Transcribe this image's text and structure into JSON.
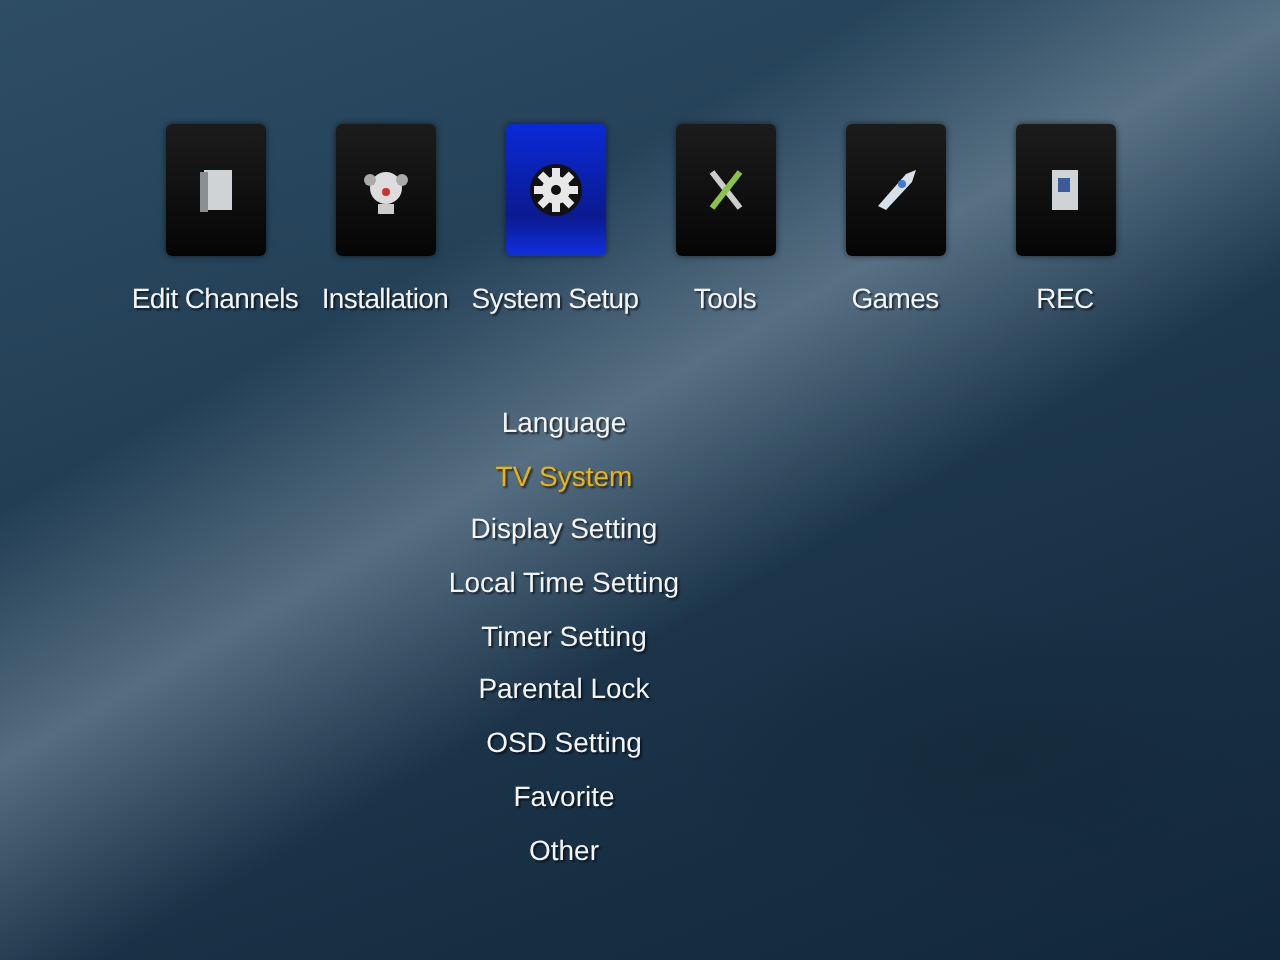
{
  "main_menu": [
    {
      "label": "Edit Channels",
      "selected": false
    },
    {
      "label": "Installation",
      "selected": false
    },
    {
      "label": "System Setup",
      "selected": true
    },
    {
      "label": "Tools",
      "selected": false
    },
    {
      "label": "Games",
      "selected": false
    },
    {
      "label": "REC",
      "selected": false
    }
  ],
  "submenu": [
    {
      "label": "Language",
      "selected": false
    },
    {
      "label": "TV System",
      "selected": true
    },
    {
      "label": "Display Setting",
      "selected": false
    },
    {
      "label": "Local Time Setting",
      "selected": false
    },
    {
      "label": "Timer Setting",
      "selected": false
    },
    {
      "label": "Parental Lock",
      "selected": false
    },
    {
      "label": "OSD Setting",
      "selected": false
    },
    {
      "label": "Favorite",
      "selected": false
    },
    {
      "label": "Other",
      "selected": false
    }
  ]
}
